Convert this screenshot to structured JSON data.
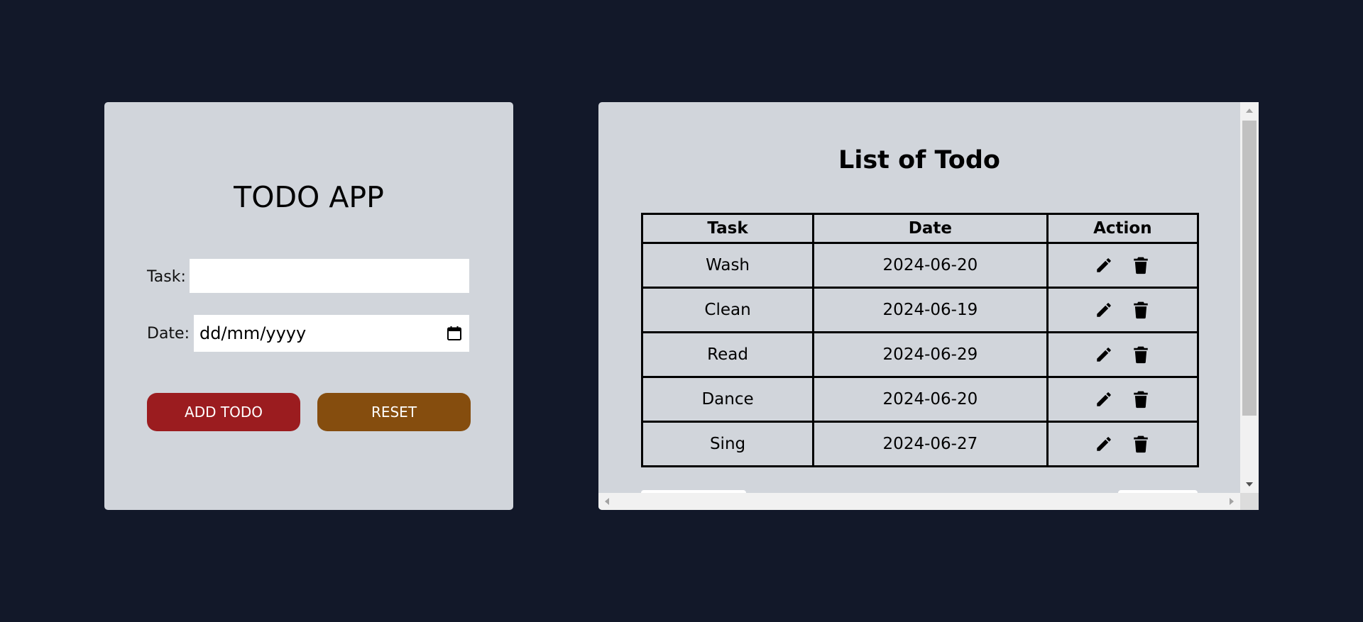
{
  "app": {
    "title": "TODO APP",
    "colors": {
      "background": "#121829",
      "card": "#d1d5db",
      "add_button": "#9b1c1f",
      "reset_button": "#854d0e"
    }
  },
  "form": {
    "task_label": "Task:",
    "task_value": "",
    "date_label": "Date:",
    "date_placeholder": "dd/mm/yyyy",
    "date_icon": "calendar-icon",
    "add_button_label": "ADD TODO",
    "reset_button_label": "RESET"
  },
  "list": {
    "title": "List of Todo",
    "columns": [
      "Task",
      "Date",
      "Action"
    ],
    "rows": [
      {
        "task": "Wash",
        "date": "2024-06-20"
      },
      {
        "task": "Clean",
        "date": "2024-06-19"
      },
      {
        "task": "Read",
        "date": "2024-06-29"
      },
      {
        "task": "Dance",
        "date": "2024-06-20"
      },
      {
        "task": "Sing",
        "date": "2024-06-27"
      }
    ],
    "row_actions": [
      "edit-pencil-icon",
      "delete-trash-icon"
    ]
  }
}
